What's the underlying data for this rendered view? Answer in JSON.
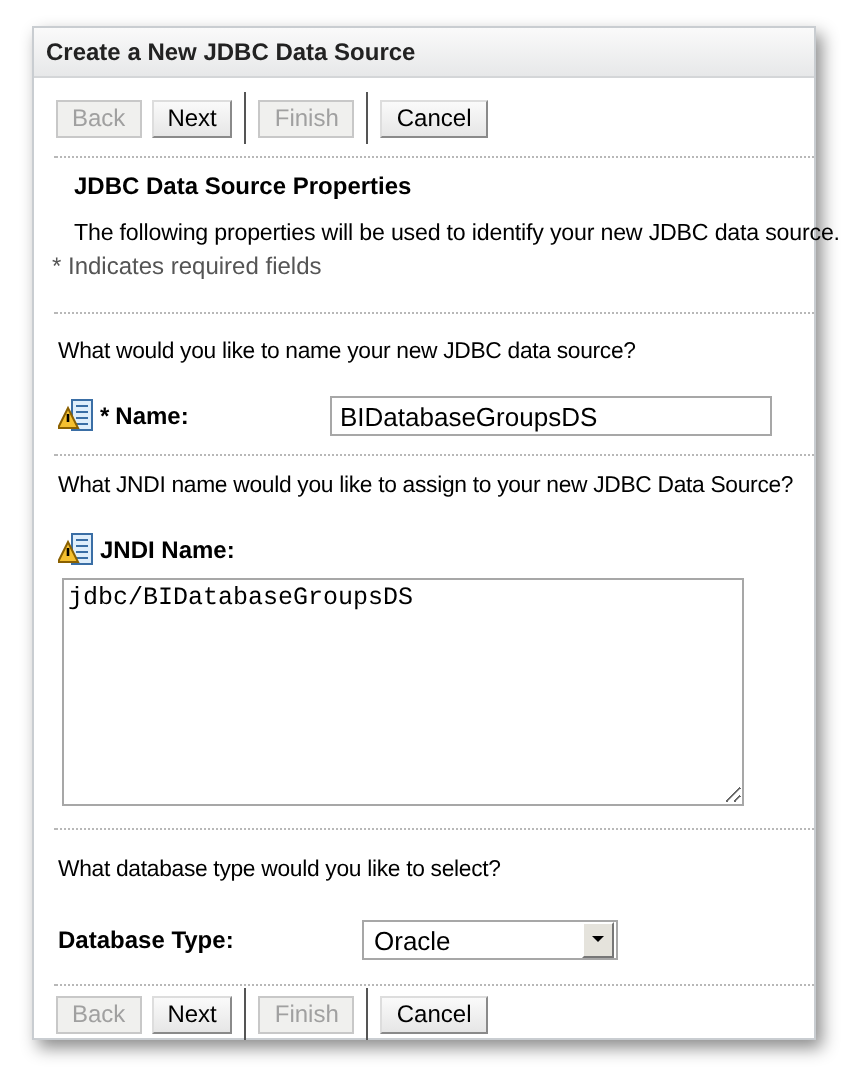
{
  "window": {
    "title": "Create a New JDBC Data Source"
  },
  "top_buttons": [
    {
      "label": "Back",
      "disabled": true,
      "separator_before": false
    },
    {
      "label": "Next",
      "disabled": false,
      "separator_before": false
    },
    {
      "label": "Finish",
      "disabled": true,
      "separator_before": true
    },
    {
      "label": "Cancel",
      "disabled": false,
      "separator_before": true
    }
  ],
  "section": {
    "heading": "JDBC Data Source Properties",
    "description": "The following properties will be used to identify your new JDBC data source.",
    "required_note": "* Indicates required fields"
  },
  "name_question": "What would you like to name your new JDBC data source?",
  "name_field": {
    "required_mark": "*",
    "label": "Name:",
    "value": "BIDatabaseGroupsDS"
  },
  "jndi_question": "What JNDI name would you like to assign to your new JDBC Data Source?",
  "jndi_field": {
    "label": "JNDI Name:",
    "value": "jdbc/BIDatabaseGroupsDS"
  },
  "db_question": "What database type would you like to select?",
  "db_field": {
    "label": "Database Type:",
    "value": "Oracle"
  },
  "bottom_buttons": [
    {
      "label": "Back",
      "disabled": true,
      "separator_before": false
    },
    {
      "label": "Next",
      "disabled": false,
      "separator_before": false
    },
    {
      "label": "Finish",
      "disabled": true,
      "separator_before": true
    },
    {
      "label": "Cancel",
      "disabled": false,
      "separator_before": true
    }
  ]
}
